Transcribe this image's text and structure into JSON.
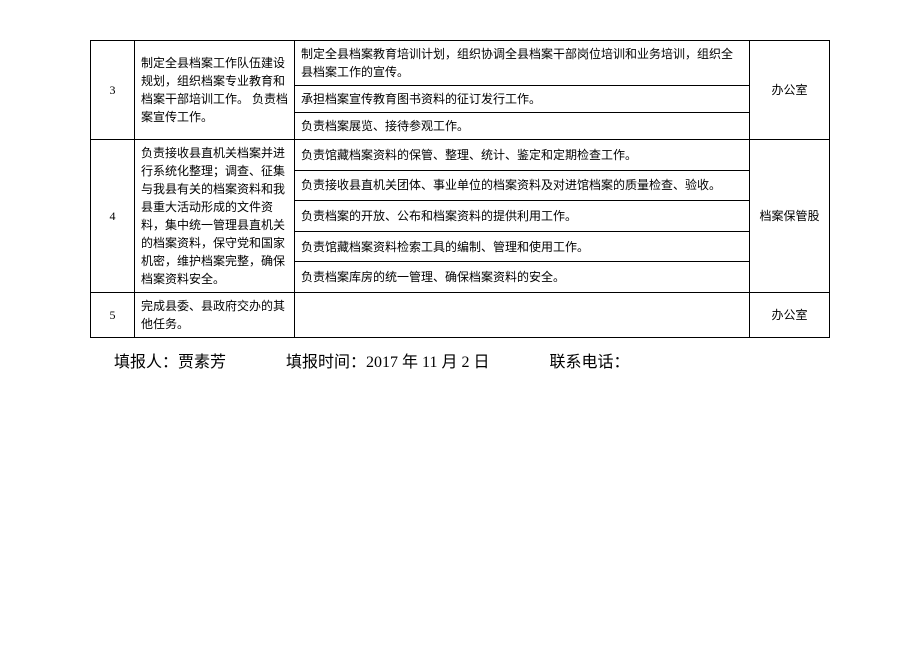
{
  "rows": [
    {
      "idx": "3",
      "desc": "制定全县档案工作队伍建设规划，组织档案专业教育和档案干部培训工作。\n负责档案宣传工作。",
      "items": [
        "制定全县档案教育培训计划，组织协调全县档案干部岗位培训和业务培训，组织全县档案工作的宣传。",
        "承担档案宣传教育图书资料的征订发行工作。",
        "负责档案展览、接待参观工作。"
      ],
      "dept": "办公室"
    },
    {
      "idx": "4",
      "desc": "负责接收县直机关档案并进行系统化整理；调查、征集与我县有关的档案资料和我县重大活动形成的文件资料，集中统一管理县直机关的档案资料，保守党和国家机密，维护档案完整，确保档案资料安全。",
      "items": [
        "负责馆藏档案资料的保管、整理、统计、鉴定和定期检查工作。",
        "负责接收县直机关团体、事业单位的档案资料及对进馆档案的质量检查、验收。",
        "负责档案的开放、公布和档案资料的提供利用工作。",
        "负责馆藏档案资料检索工具的编制、管理和使用工作。",
        "负责档案库房的统一管理、确保档案资料的安全。"
      ],
      "dept": "档案保管股"
    },
    {
      "idx": "5",
      "desc": "完成县委、县政府交办的其他任务。",
      "items": [
        ""
      ],
      "dept": "办公室"
    }
  ],
  "footer": {
    "reporter_label": "填报人：",
    "reporter_name": "贾素芳",
    "time_label": "填报时间：",
    "time_value": "2017 年 11 月 2 日",
    "phone_label": "联系电话："
  }
}
